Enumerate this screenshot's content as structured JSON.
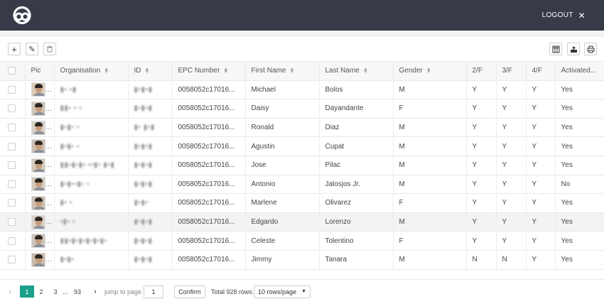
{
  "header": {
    "logout_label": "LOGOUT",
    "close_glyph": "✕"
  },
  "toolbar": {
    "add_glyph": "+",
    "edit_glyph": "✎",
    "delete_glyph": "🗑",
    "columns_glyph": "▦",
    "export_glyph": "⏏",
    "print_glyph": "⎙"
  },
  "table": {
    "columns": [
      "Pic",
      "Organisation",
      "ID",
      "EPC Number",
      "First Name",
      "Last Name",
      "Gender",
      "2/F",
      "3/F",
      "4/F",
      "Activated..."
    ],
    "rows": [
      {
        "org": "▮▪ ▪▮",
        "id": "▮▪▮▪▮",
        "epc": "0058052c17016...",
        "first": "Michael",
        "last": "Bolos",
        "gender": "M",
        "f2": "Y",
        "f3": "Y",
        "f4": "Y",
        "active": "Yes"
      },
      {
        "org": "▮▮▪ ▪ ▪",
        "id": "▮▪▮▪▮",
        "epc": "0058052c17016...",
        "first": "Daisy",
        "last": "Dayandante",
        "gender": "F",
        "f2": "Y",
        "f3": "Y",
        "f4": "Y",
        "active": "Yes"
      },
      {
        "org": "▮▪▮▪ ▪",
        "id": "▮▪ ▮▪▮",
        "epc": "0058052c17016...",
        "first": "Ronald",
        "last": "Diaz",
        "gender": "M",
        "f2": "Y",
        "f3": "Y",
        "f4": "Y",
        "active": "Yes"
      },
      {
        "org": "▮▪▮▪ ▪",
        "id": "▮▪▮▪▮",
        "epc": "0058052c17016...",
        "first": "Agustin",
        "last": "Cupat",
        "gender": "M",
        "f2": "Y",
        "f3": "Y",
        "f4": "Y",
        "active": "Yes"
      },
      {
        "org": "▮▮▪▮▪▮▪ ▪▪▮▪ ▮▪▮",
        "id": "▮▪▮▪▮",
        "epc": "0058052c17016...",
        "first": "Jose",
        "last": "Pilac",
        "gender": "M",
        "f2": "Y",
        "f3": "Y",
        "f4": "Y",
        "active": "Yes"
      },
      {
        "org": "▮▪▮▪▪▮▪ ▪",
        "id": "▮▪▮▪▮",
        "epc": "0058052c17016...",
        "first": "Antonio",
        "last": "Jalosjos Jr.",
        "gender": "M",
        "f2": "Y",
        "f3": "Y",
        "f4": "Y",
        "active": "No"
      },
      {
        "org": "▮▪ ▪",
        "id": "▮▪▮▪",
        "epc": "0058052c17016...",
        "first": "Marlene",
        "last": "Olivarez",
        "gender": "F",
        "f2": "Y",
        "f3": "Y",
        "f4": "Y",
        "active": "Yes"
      },
      {
        "org": "▪▮▪ ▪",
        "id": "▮▪▮▪▮",
        "epc": "0058052c17016...",
        "first": "Edgardo",
        "last": "Lorenzo",
        "gender": "M",
        "f2": "Y",
        "f3": "Y",
        "f4": "Y",
        "active": "Yes"
      },
      {
        "org": "▮▮▪▮▪▮▪▮▪▮▪▮▪",
        "id": "▮▪▮▪▮",
        "epc": "0058052c17016...",
        "first": "Celeste",
        "last": "Tolentino",
        "gender": "F",
        "f2": "Y",
        "f3": "Y",
        "f4": "Y",
        "active": "Yes"
      },
      {
        "org": "▮▪▮▪",
        "id": "▮▪▮▪▮",
        "epc": "0058052c17016...",
        "first": "Jimmy",
        "last": "Tanara",
        "gender": "M",
        "f2": "N",
        "f3": "N",
        "f4": "Y",
        "active": "Yes"
      }
    ]
  },
  "pagination": {
    "prev_glyph": "‹",
    "next_glyph": "›",
    "pages": [
      "1",
      "2",
      "3",
      "...",
      "93"
    ],
    "jump_label": "jump to page",
    "jump_value": "1",
    "confirm_label": "Confirm",
    "total_label": "Total 928 rows",
    "page_size": "10 rows/page"
  },
  "colors": {
    "header_bg": "#363b47",
    "accent": "#19a08a"
  }
}
